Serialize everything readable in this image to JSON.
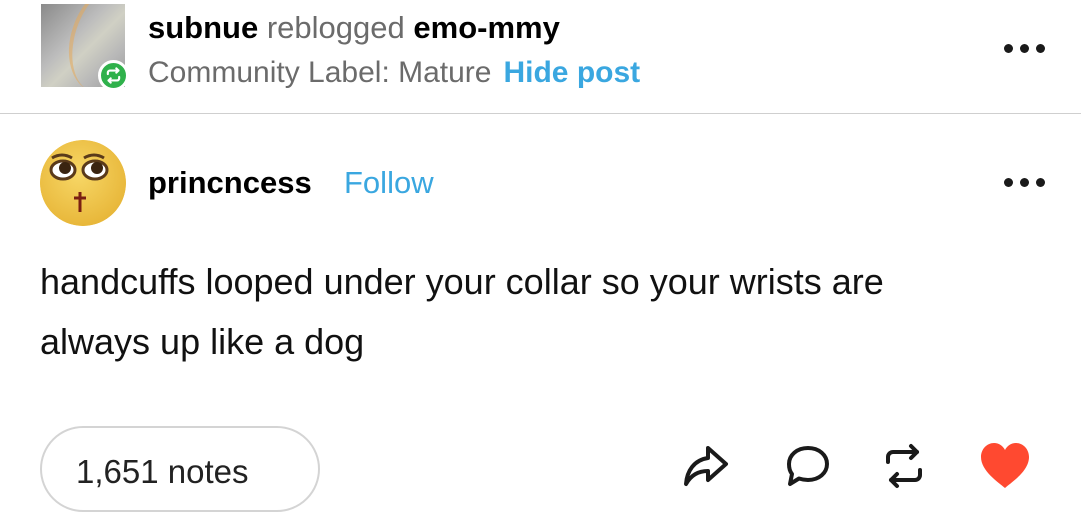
{
  "reblog": {
    "username": "subnue",
    "verb": "reblogged",
    "source": "emo-mmy",
    "community_label": "Community Label: Mature",
    "hide_link": "Hide post"
  },
  "post": {
    "username": "princncess",
    "follow_label": "Follow",
    "body_lines": [
      "handcuffs looped under your collar so your wrists are",
      "always up like a dog"
    ]
  },
  "footer": {
    "notes": "1,651 notes",
    "icons": [
      "share-icon",
      "comment-icon",
      "reblog-icon",
      "like-heart-icon"
    ]
  },
  "colors": {
    "link_blue": "#3aa7e0",
    "reblog_green": "#2fb14b",
    "like_red": "#ff4930",
    "muted_text": "#6b6b6b"
  }
}
